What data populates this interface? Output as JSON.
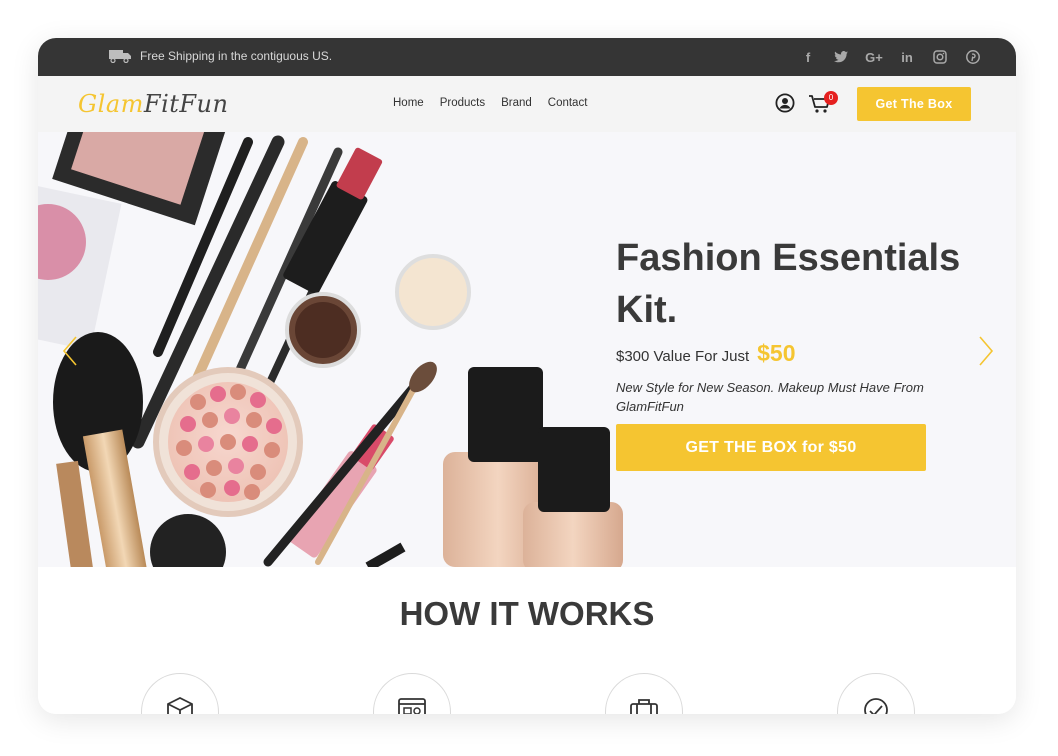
{
  "topbar": {
    "shipping_text": "Free Shipping in the contiguous US.",
    "social_icons": [
      "facebook-icon",
      "twitter-icon",
      "google-plus-icon",
      "linkedin-icon",
      "instagram-icon",
      "pinterest-icon"
    ]
  },
  "nav": {
    "logo_part1": "Glam",
    "logo_part2": "FitFun",
    "menu": [
      "Home",
      "Products",
      "Brand",
      "Contact"
    ],
    "cart_count": "0",
    "cta_label": "Get The Box"
  },
  "hero": {
    "title_line1": "Fashion Essentials",
    "title_line2": "Kit.",
    "value_text": "$300 Value For Just",
    "price": "$50",
    "description": "New Style for New Season. Makeup Must Have From GlamFitFun",
    "cta_label": "GET THE BOX for $50"
  },
  "how_it_works": {
    "title": "HOW IT WORKS",
    "steps": [
      "box-icon",
      "computer-icon",
      "luggage-icon",
      "badge-icon"
    ]
  },
  "colors": {
    "accent": "#f5c531",
    "topbar": "#353535",
    "nav_bg": "#f4f4f4",
    "text": "#3a3a3a",
    "badge": "#e5201f"
  }
}
